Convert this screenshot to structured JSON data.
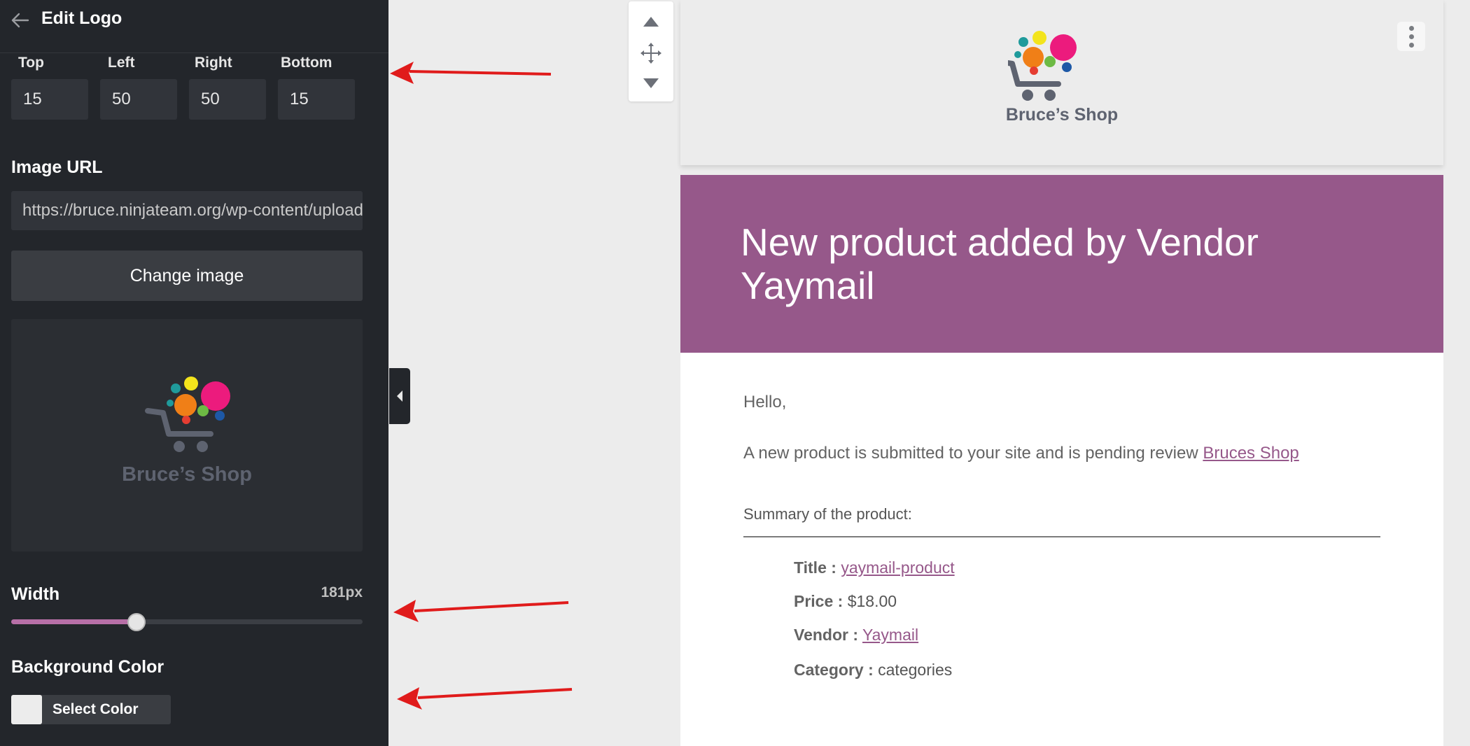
{
  "sidebar": {
    "title": "Edit Logo",
    "padding": {
      "top_label": "Top",
      "top_value": "15",
      "left_label": "Left",
      "left_value": "50",
      "right_label": "Right",
      "right_value": "50",
      "bottom_label": "Bottom",
      "bottom_value": "15"
    },
    "image_url_label": "Image URL",
    "image_url_value": "https://bruce.ninjateam.org/wp-content/uploads/",
    "change_image_label": "Change image",
    "preview_logo_text": "Bruce’s Shop",
    "width_label": "Width",
    "width_value": "181px",
    "width_fraction": 0.356,
    "background_color_label": "Background Color",
    "select_color_label": "Select Color",
    "swatch_color": "#ececec"
  },
  "email": {
    "logo_text": "Bruce’s Shop",
    "banner_title": "New product added by Vendor Yaymail",
    "banner_color": "#96588a",
    "greeting": "Hello,",
    "intro_text": "A new product is submitted to your site and is pending review ",
    "intro_link": "Bruces Shop",
    "summary_heading": "Summary of the product:",
    "title_label": "Title :",
    "title_value": "yaymail-product",
    "price_label": "Price :",
    "price_value": "$18.00",
    "vendor_label": "Vendor :",
    "vendor_value": "Yaymail",
    "category_label": "Category :",
    "category_value": "categories"
  },
  "colors": {
    "sidebar_bg": "#23262b",
    "accent": "#96588a",
    "arrow": "#e01b1b"
  }
}
